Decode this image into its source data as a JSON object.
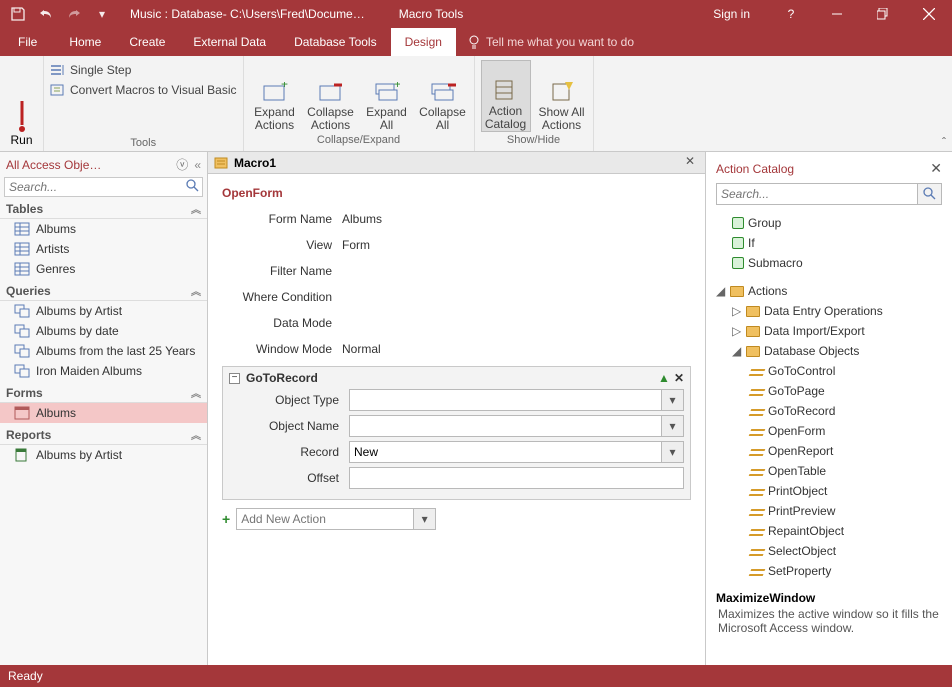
{
  "titlebar": {
    "title": "Music : Database- C:\\Users\\Fred\\Docume…",
    "context": "Macro Tools",
    "signin": "Sign in"
  },
  "tabs": {
    "file": "File",
    "home": "Home",
    "create": "Create",
    "external": "External Data",
    "dbtools": "Database Tools",
    "design": "Design",
    "tellme": "Tell me what you want to do"
  },
  "ribbon": {
    "run": "Run",
    "single_step": "Single Step",
    "convert": "Convert Macros to Visual Basic",
    "tools_label": "Tools",
    "expand_actions1": "Expand",
    "expand_actions2": "Actions",
    "collapse_actions1": "Collapse",
    "collapse_actions2": "Actions",
    "expand_all1": "Expand",
    "expand_all2": "All",
    "collapse_all1": "Collapse",
    "collapse_all2": "All",
    "ce_label": "Collapse/Expand",
    "action_catalog1": "Action",
    "action_catalog2": "Catalog",
    "show_all1": "Show All",
    "show_all2": "Actions",
    "sh_label": "Show/Hide"
  },
  "nav": {
    "header": "All Access Obje…",
    "search_ph": "Search...",
    "groups": {
      "tables": "Tables",
      "queries": "Queries",
      "forms": "Forms",
      "reports": "Reports"
    },
    "tables": [
      "Albums",
      "Artists",
      "Genres"
    ],
    "queries": [
      "Albums by Artist",
      "Albums by date",
      "Albums from the last 25 Years",
      "Iron Maiden Albums"
    ],
    "forms": [
      "Albums"
    ],
    "reports": [
      "Albums by Artist"
    ]
  },
  "doc": {
    "tabname": "Macro1",
    "openform": {
      "title": "OpenForm",
      "labels": {
        "form_name": "Form Name",
        "view": "View",
        "filter": "Filter Name",
        "where": "Where Condition",
        "datamode": "Data Mode",
        "window": "Window Mode"
      },
      "values": {
        "form_name": "Albums",
        "view": "Form",
        "filter": "",
        "where": "",
        "datamode": "",
        "window": "Normal"
      }
    },
    "goto": {
      "title": "GoToRecord",
      "labels": {
        "objtype": "Object Type",
        "objname": "Object Name",
        "record": "Record",
        "offset": "Offset"
      },
      "values": {
        "objtype": "",
        "objname": "",
        "record": "New",
        "offset": ""
      }
    },
    "addnew_ph": "Add New Action"
  },
  "catalog": {
    "header": "Action Catalog",
    "search_ph": "Search...",
    "flow": {
      "group": "Group",
      "if": "If",
      "submacro": "Submacro"
    },
    "actions_label": "Actions",
    "cats": {
      "entry": "Data Entry Operations",
      "ie": "Data Import/Export",
      "db": "Database Objects"
    },
    "db_items": [
      "GoToControl",
      "GoToPage",
      "GoToRecord",
      "OpenForm",
      "OpenReport",
      "OpenTable",
      "PrintObject",
      "PrintPreview",
      "RepaintObject",
      "SelectObject",
      "SetProperty"
    ],
    "tip": {
      "title": "MaximizeWindow",
      "body": "Maximizes the active window so it fills the Microsoft Access window."
    }
  },
  "status": {
    "ready": "Ready"
  }
}
